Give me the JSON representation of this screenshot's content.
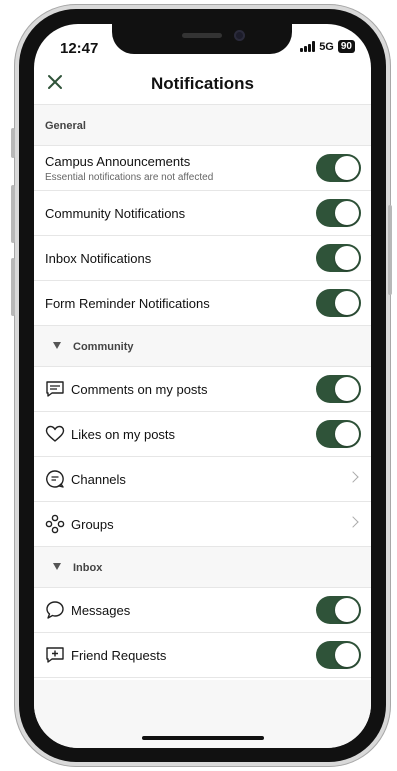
{
  "status_bar": {
    "time": "12:47",
    "network": "5G",
    "battery": "90"
  },
  "header": {
    "title": "Notifications",
    "close_icon": "close-icon"
  },
  "colors": {
    "accent": "#2f5339"
  },
  "sections": {
    "general": {
      "label": "General"
    },
    "community": {
      "label": "Community"
    },
    "inbox": {
      "label": "Inbox"
    }
  },
  "general_items": {
    "campus": {
      "label": "Campus Announcements",
      "sub": "Essential notifications are not affected",
      "on": true
    },
    "community": {
      "label": "Community Notifications",
      "on": true
    },
    "inbox": {
      "label": "Inbox Notifications",
      "on": true
    },
    "form": {
      "label": "Form Reminder Notifications",
      "on": true
    }
  },
  "community_items": {
    "comments": {
      "label": "Comments on my posts",
      "icon": "comment-icon",
      "on": true
    },
    "likes": {
      "label": "Likes on my posts",
      "icon": "heart-icon",
      "on": true
    },
    "channels": {
      "label": "Channels",
      "icon": "channel-icon"
    },
    "groups": {
      "label": "Groups",
      "icon": "groups-icon"
    }
  },
  "inbox_items": {
    "messages": {
      "label": "Messages",
      "icon": "message-icon",
      "on": true
    },
    "friends": {
      "label": "Friend Requests",
      "icon": "friend-request-icon",
      "on": true
    }
  }
}
